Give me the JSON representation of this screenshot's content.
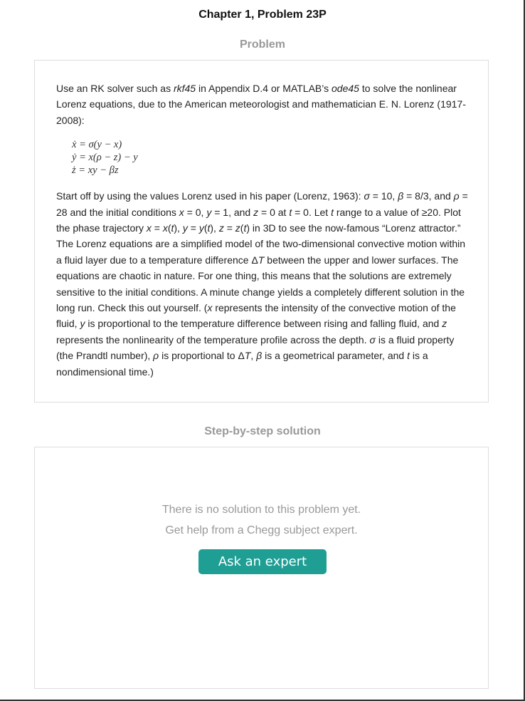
{
  "header": {
    "chapter_title": "Chapter 1, Problem 23P"
  },
  "problem": {
    "heading": "Problem",
    "intro": {
      "s1": "Use an RK solver such as ",
      "rkf45": "rkf45",
      "s2": " in Appendix D.4 or MATLAB’s ",
      "ode45": "ode45",
      "s3": " to solve the nonlinear Lorenz equations, due to the American meteorologist and mathematician E. N. Lorenz (1917-2008):"
    },
    "equations": {
      "eq1": {
        "lhs": "ẋ",
        "rhs": " = σ(y − x)"
      },
      "eq2": {
        "lhs": "ẏ",
        "rhs": " = x(ρ − z) − y"
      },
      "eq3": {
        "lhs": "ż",
        "rhs": " = xy − βz"
      }
    },
    "body": {
      "t01": "Start off by using the values Lorenz used in his paper (Lorenz, 1963): ",
      "i01": "σ",
      "t02": " = 10, ",
      "i02": "β",
      "t03": " = 8/3, and ",
      "i03": "ρ",
      "t04": " = 28 and the initial conditions ",
      "i04": "x",
      "t05": " = 0, ",
      "i05": "y",
      "t06": " = 1, and ",
      "i06": "z",
      "t07": " = 0 at ",
      "i07": "t",
      "t08": " = 0. Let ",
      "i08": "t",
      "t09": " range to a value of ≥20. Plot the phase trajectory ",
      "i09": "x",
      "t10": " = ",
      "i10": "x",
      "t11": "(",
      "i11": "t",
      "t12": "), ",
      "i12": "y",
      "t13": " = ",
      "i13": "y",
      "t14": "(",
      "i14": "t",
      "t15": "), ",
      "i15": "z",
      "t16": " = ",
      "i16": "z",
      "t17": "(",
      "i17": "t",
      "t18": ") in 3D to see the now-famous “Lorenz attractor.” The Lorenz equations are a simplified model of the two-dimensional convective motion within a fluid layer due to a temperature difference Δ",
      "i18": "T",
      "t19": " between the upper and lower surfaces. The equations are chaotic in nature. For one thing, this means that the solutions are extremely sensitive to the initial conditions. A minute change yields a completely different solution in the long run. Check this out yourself. (",
      "i19": "x",
      "t20": " represents the intensity of the convective motion of the fluid, ",
      "i20": "y",
      "t21": " is proportional to the temperature difference between rising and falling fluid, and ",
      "i21": "z",
      "t22": " represents the nonlinearity of the temperature profile across the depth. ",
      "i22": "σ",
      "t23": " is a fluid property (the Prandtl number), ",
      "i23": "ρ",
      "t24": " is proportional to Δ",
      "i24": "T",
      "t25": ", ",
      "i25": "β",
      "t26": " is a geometrical parameter, and ",
      "i26": "t",
      "t27": " is a nondimensional time.)"
    }
  },
  "solution": {
    "heading": "Step-by-step solution",
    "no_solution_text": "There is no solution to this problem yet.",
    "help_text": "Get help from a Chegg subject expert.",
    "ask_button_label": "Ask an expert",
    "button_color": "#1f9e94"
  }
}
